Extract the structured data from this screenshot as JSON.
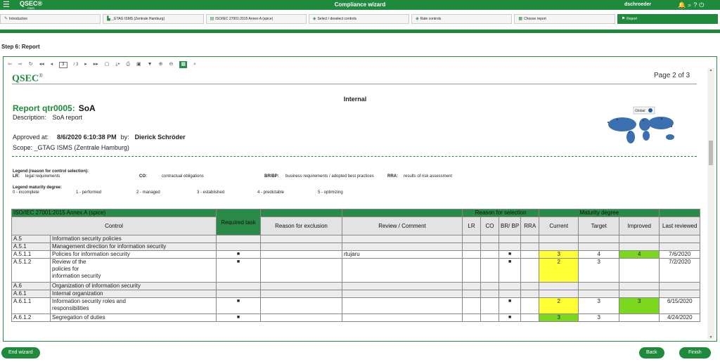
{
  "app": {
    "title": "Compliance wizard",
    "logo": "QSEC",
    "logo_sub": "ISMS",
    "user": "dschroeder",
    "menu_icon": "hamburger-icon",
    "icons": [
      "bell-icon",
      "search-icon",
      "help-icon",
      "logout-icon"
    ]
  },
  "steps": [
    {
      "label": "Introduction",
      "icon": "pencil-icon"
    },
    {
      "label": "_GTAG ISMS (Zentrale Hamburg)",
      "icon": "building-icon"
    },
    {
      "label": "ISO/IEC 27001:2015 Annex A (spice)",
      "icon": "document-icon"
    },
    {
      "label": "Select / deselect controls",
      "icon": "controls-icon"
    },
    {
      "label": "Rate controls",
      "icon": "rating-icon"
    },
    {
      "label": "Choose report",
      "icon": "report-icon"
    },
    {
      "label": "Report",
      "icon": "flag-icon"
    }
  ],
  "progress": 1.0,
  "step_title": "Step 6: Report",
  "viewer": {
    "page_input": "3",
    "page_of": "/ 3",
    "page_label": "Page 2 of 3"
  },
  "report": {
    "logo": "QSEC",
    "classification": "Internal",
    "title_prefix": "Report qtr0005:",
    "title_name": "SoA",
    "description_label": "Description:",
    "description_value": "SoA report",
    "approved_label": "Approved at:",
    "approved_value": "8/6/2020 6:10:38 PM",
    "by_label": "by:",
    "by_value": "Dierick Schröder",
    "scope_label": "Scope:",
    "scope_value": "_GTAG ISMS (Zentrale Hamburg)",
    "map_badge": "Global"
  },
  "legend": {
    "reason_title": "Legend (reason for control selection):",
    "lr_key": "LR:",
    "lr_val": "legal requirements",
    "co_key": "CO:",
    "co_val": "contractual obligations",
    "brbp_key": "BR/BP:",
    "brbp_val": "business requirements / adopted best practices",
    "rra_key": "RRA:",
    "rra_val": "results of risk assessment",
    "maturity_title": "Legend maturity degree:",
    "m0": "0 - incomplete",
    "m1": "1 - performed",
    "m2": "2 - managed",
    "m3": "3 - established",
    "m4": "4 - predictable",
    "m5": "5 - optimizing"
  },
  "table": {
    "framework": "ISO/IEC 27001:2015 Annex A (spice)",
    "required_task": "Required task",
    "reason_group": "Reason for selection",
    "maturity_group": "Maturity degree",
    "headers": {
      "control": "Control",
      "reason_excl": "Reason for exclusion",
      "review": "Review / Comment",
      "lr": "LR",
      "co": "CO",
      "brbp": "BR/ BP",
      "rra": "RRA",
      "current": "Current",
      "target": "Target",
      "improved": "Improved",
      "last_reviewed": "Last reviewed"
    },
    "rows": [
      {
        "id": "A.5",
        "name": "Information security policies",
        "group": true
      },
      {
        "id": "A.5.1",
        "name": "Management direction for information security",
        "group": true
      },
      {
        "id": "A.5.1.1",
        "name": "Policies for information security",
        "req": "■",
        "review": "rtujaru",
        "brbp": "■",
        "current": "3",
        "target": "4",
        "improved": "4",
        "last": "7/6/2020",
        "cur_color": "#ffff33",
        "imp_color": "#7bd81e"
      },
      {
        "id": "A.5.1.2",
        "name": "Review of the policies for information security",
        "req": "■",
        "brbp": "■",
        "current": "2",
        "target": "3",
        "last": "7/2/2020",
        "cur_color": "#ffff33"
      },
      {
        "id": "A.6",
        "name": "Organization of information security",
        "group": true
      },
      {
        "id": "A.6.1",
        "name": "Internal organization",
        "group": true
      },
      {
        "id": "A.6.1.1",
        "name": "Information security roles and responsibilities",
        "req": "■",
        "brbp": "■",
        "current": "2",
        "target": "3",
        "improved": "3",
        "last": "6/15/2020",
        "cur_color": "#ffff33",
        "imp_color": "#7bd81e"
      },
      {
        "id": "A.6.1.2",
        "name": "Segregation of duties",
        "req": "■",
        "brbp": "■",
        "current": "3",
        "target": "3",
        "last": "4/24/2020",
        "cur_color": "#7bd81e"
      }
    ]
  },
  "buttons": {
    "end_wizard": "End wizard",
    "back": "Back",
    "finish": "Finish"
  }
}
